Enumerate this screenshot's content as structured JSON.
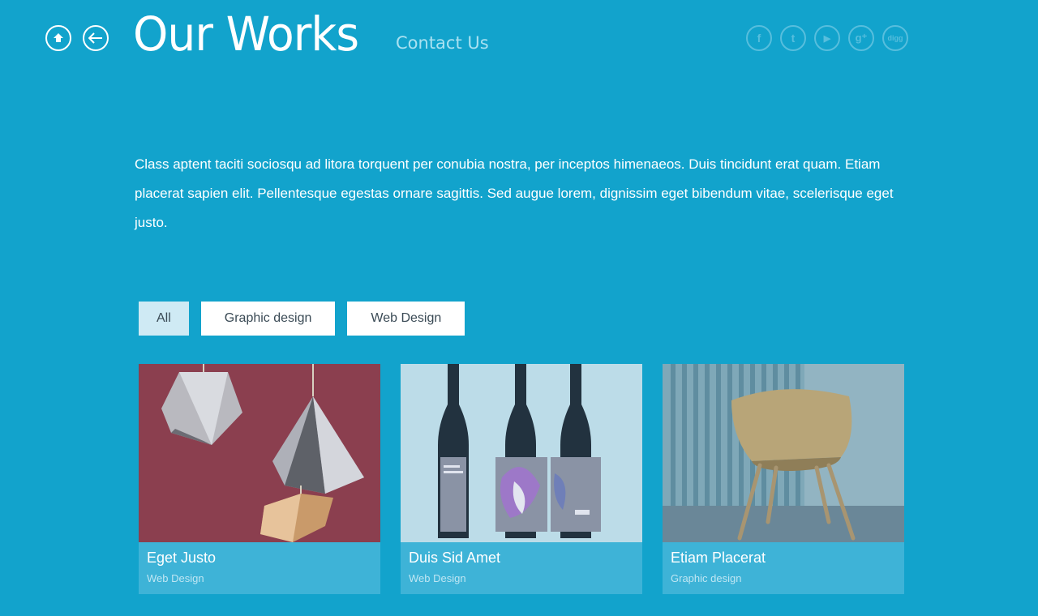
{
  "header": {
    "title": "Our Works",
    "contact_label": "Contact Us",
    "home_icon": "home-icon",
    "back_icon": "back-arrow-icon"
  },
  "social": [
    {
      "name": "facebook-icon",
      "glyph": "f"
    },
    {
      "name": "twitter-icon",
      "glyph": "t"
    },
    {
      "name": "youtube-icon",
      "glyph": "▶"
    },
    {
      "name": "google-plus-icon",
      "glyph": "g⁺"
    },
    {
      "name": "digg-icon",
      "glyph": "digg"
    }
  ],
  "intro": "Class aptent taciti sociosqu ad litora torquent per conubia nostra, per inceptos himenaeos. Duis tincidunt erat quam. Etiam placerat sapien elit. Pellentesque egestas ornare sagittis. Sed augue lorem, dignissim eget bibendum vitae, scelerisque eget justo.",
  "filters": [
    {
      "label": "All",
      "active": true
    },
    {
      "label": "Graphic design",
      "active": false
    },
    {
      "label": "Web Design",
      "active": false
    }
  ],
  "works": [
    {
      "title": "Eget Justo",
      "category": "Web Design"
    },
    {
      "title": "Duis Sid Amet",
      "category": "Web Design"
    },
    {
      "title": "Etiam Placerat",
      "category": "Graphic design"
    }
  ],
  "colors": {
    "background": "#12a3cc",
    "caption": "#3eb3d7",
    "active_filter": "#cfeaf4"
  }
}
